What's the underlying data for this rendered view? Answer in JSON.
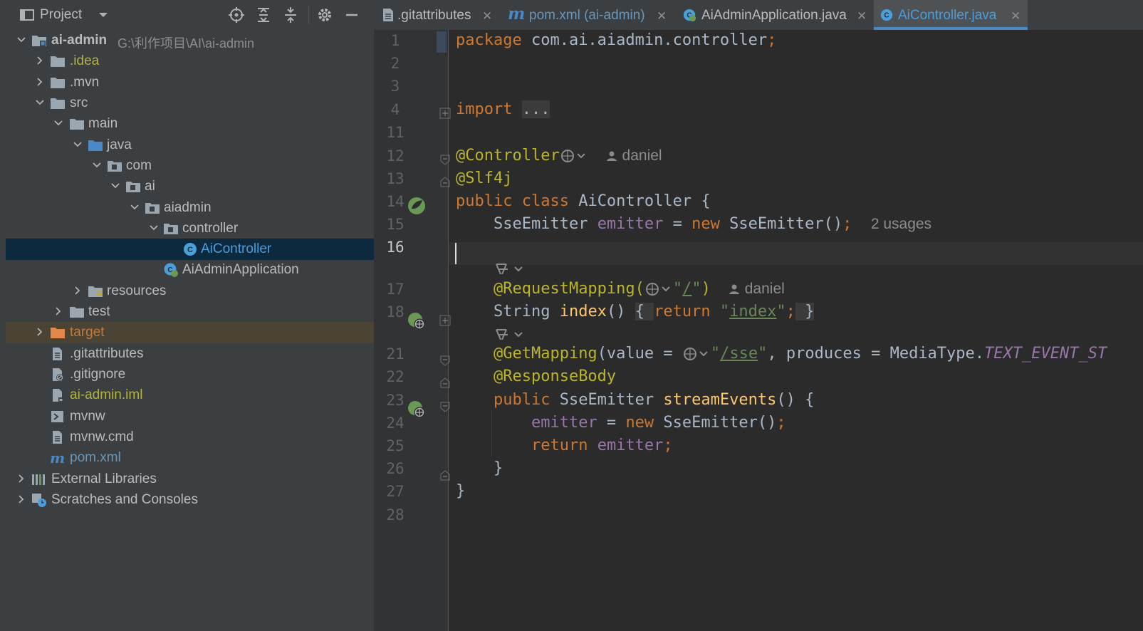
{
  "project_panel": {
    "title": "Project",
    "tree": [
      {
        "label": "ai-admin",
        "sub": "G:\\利作项目\\AI\\ai-admin",
        "icon": "module-folder-icon",
        "color": "#bbbbbb"
      },
      {
        "label": ".idea",
        "icon": "folder-icon",
        "color": "#b4b245"
      },
      {
        "label": ".mvn",
        "icon": "folder-icon",
        "color": "#bbbbbb"
      },
      {
        "label": "src",
        "icon": "folder-icon",
        "color": "#bbbbbb"
      },
      {
        "label": "main",
        "icon": "folder-icon",
        "color": "#bbbbbb"
      },
      {
        "label": "java",
        "icon": "source-folder-icon",
        "color": "#bbbbbb"
      },
      {
        "label": "com",
        "icon": "package-icon",
        "color": "#bbbbbb"
      },
      {
        "label": "ai",
        "icon": "package-icon",
        "color": "#bbbbbb"
      },
      {
        "label": "aiadmin",
        "icon": "package-icon",
        "color": "#bbbbbb"
      },
      {
        "label": "controller",
        "icon": "package-icon",
        "color": "#bbbbbb"
      },
      {
        "label": "AiController",
        "icon": "java-class-icon",
        "color": "#4a9eda"
      },
      {
        "label": "AiAdminApplication",
        "icon": "spring-boot-class-icon",
        "color": "#bbbbbb"
      },
      {
        "label": "resources",
        "icon": "resources-folder-icon",
        "color": "#bbbbbb"
      },
      {
        "label": "test",
        "icon": "folder-icon",
        "color": "#bbbbbb"
      },
      {
        "label": "target",
        "icon": "excluded-folder-icon",
        "color": "#c07a3c"
      },
      {
        "label": ".gitattributes",
        "icon": "text-file-icon",
        "color": "#bbbbbb"
      },
      {
        "label": ".gitignore",
        "icon": "ignore-file-icon",
        "color": "#bbbbbb"
      },
      {
        "label": "ai-admin.iml",
        "icon": "iml-file-icon",
        "color": "#b4b245"
      },
      {
        "label": "mvnw",
        "icon": "shell-file-icon",
        "color": "#bbbbbb"
      },
      {
        "label": "mvnw.cmd",
        "icon": "text-file-icon",
        "color": "#bbbbbb"
      },
      {
        "label": "pom.xml",
        "icon": "maven-icon",
        "color": "#6897bb"
      },
      {
        "label": "External Libraries",
        "icon": "libraries-icon",
        "color": "#bbbbbb"
      },
      {
        "label": "Scratches and Consoles",
        "icon": "scratches-icon",
        "color": "#bbbbbb"
      }
    ]
  },
  "tabs": [
    {
      "label": ".gitattributes",
      "icon": "text-file-icon",
      "color": "#bbbbbb"
    },
    {
      "label": "pom.xml (ai-admin)",
      "icon": "maven-icon",
      "color": "#6897bb"
    },
    {
      "label": "AiAdminApplication.java",
      "icon": "spring-boot-class-icon",
      "color": "#bbbbbb"
    },
    {
      "label": "AiController.java",
      "icon": "java-class-icon",
      "color": "#4a9eda"
    }
  ],
  "editor": {
    "line_numbers": [
      "1",
      "2",
      "3",
      "4",
      "11",
      "12",
      "13",
      "14",
      "15",
      "16",
      "17",
      "18",
      "21",
      "22",
      "23",
      "24",
      "25",
      "26",
      "27",
      "28"
    ],
    "current_line": "16",
    "code": {
      "package_kw": "package",
      "package_name": " com.ai.aiadmin.controller",
      "semi": ";",
      "import_kw": "import",
      "import_fold": "...",
      "controller_ann": "@Controller",
      "author": "daniel",
      "slf4j_ann": "@Slf4j",
      "class_kw": "public class",
      "class_name": " AiController {",
      "emitter_type": "SseEmitter ",
      "emitter_field": "emitter",
      "emitter_assign": " = ",
      "new_kw": "new",
      "emitter_ctor": " SseEmitter()",
      "usages": "2 usages",
      "req_mapping": "@RequestMapping(",
      "req_path_q1": "\"",
      "req_path": "/",
      "req_path_q2": "\"",
      "req_close": ")",
      "string_type": "String ",
      "index_fn": "index",
      "index_parens": "() ",
      "brace_open": "{ ",
      "return_kw": "return",
      "index_q1": " \"",
      "index_val": "index",
      "index_q2": "\"",
      "index_end": "; }",
      "get_mapping": "@GetMapping",
      "get_args": "(value = ",
      "sse_q1": "\"",
      "sse_path": "/sse",
      "sse_q2": "\"",
      "produces": ", produces = MediaType.",
      "event_stream": "TEXT_EVENT_ST",
      "response_body": "@ResponseBody",
      "stream_type": "SseEmitter ",
      "stream_fn": "streamEvents",
      "stream_rest": "() {",
      "emitter_reassign": " = ",
      "return_emitter": "emitter",
      "close_brace_inner": "}",
      "close_brace_outer": "}"
    }
  }
}
